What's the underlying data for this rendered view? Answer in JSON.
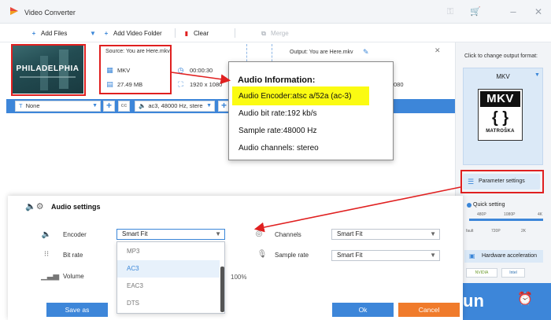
{
  "window": {
    "title": "Video Converter"
  },
  "toolbar": {
    "add_files": "Add Files",
    "add_video_folder": "Add Video Folder",
    "clear": "Clear",
    "merge": "Merge"
  },
  "source": {
    "label": "Source: You are Here.mkv",
    "format": "MKV",
    "duration": "00:00:30",
    "size": "27.49 MB",
    "resolution": "1920 x 1080",
    "thumbnail_title": "PHILADELPHIA"
  },
  "output": {
    "label": "Output: You are Here.mkv",
    "resolution_partial": "080"
  },
  "strip": {
    "subtitle": "None",
    "audio_track": "ac3, 48000 Hz, stere"
  },
  "audio_info": {
    "title": "Audio Information:",
    "encoder": "Audio Encoder:atsc a/52a (ac-3)",
    "bitrate": "Audio bit rate:192 kb/s",
    "sample_rate": "Sample rate:48000 Hz",
    "channels": "Audio channels: stereo"
  },
  "right_panel": {
    "hint": "Click to change output format:",
    "format": "MKV",
    "logo_top": "MKV",
    "logo_bottom": "MATROŠKA",
    "parameter_settings": "Parameter settings",
    "quick_setting": "Quick setting",
    "ticks_top": [
      "480P",
      "1080P",
      "4K"
    ],
    "ticks_bottom": [
      "fault",
      "720P",
      "2K"
    ],
    "hardware_acceleration": "Hardware acceleration",
    "chips": [
      "NVIDIA",
      "Intel"
    ],
    "run": "un"
  },
  "audio_settings": {
    "title": "Audio settings",
    "encoder_label": "Encoder",
    "encoder_value": "Smart Fit",
    "bitrate_label": "Bit rate",
    "volume_label": "Volume",
    "volume_value": "100%",
    "channels_label": "Channels",
    "channels_value": "Smart Fit",
    "sample_rate_label": "Sample rate",
    "sample_rate_value": "Smart Fit",
    "encoder_options": [
      "MP3",
      "AC3",
      "EAC3",
      "DTS"
    ],
    "selected_option": "AC3",
    "save_as": "Save as",
    "ok": "Ok",
    "cancel": "Cancel"
  },
  "colors": {
    "accent": "#3d86d9",
    "highlight": "#fbfb12",
    "annotation_red": "#e02020",
    "cancel": "#f07b2b"
  }
}
